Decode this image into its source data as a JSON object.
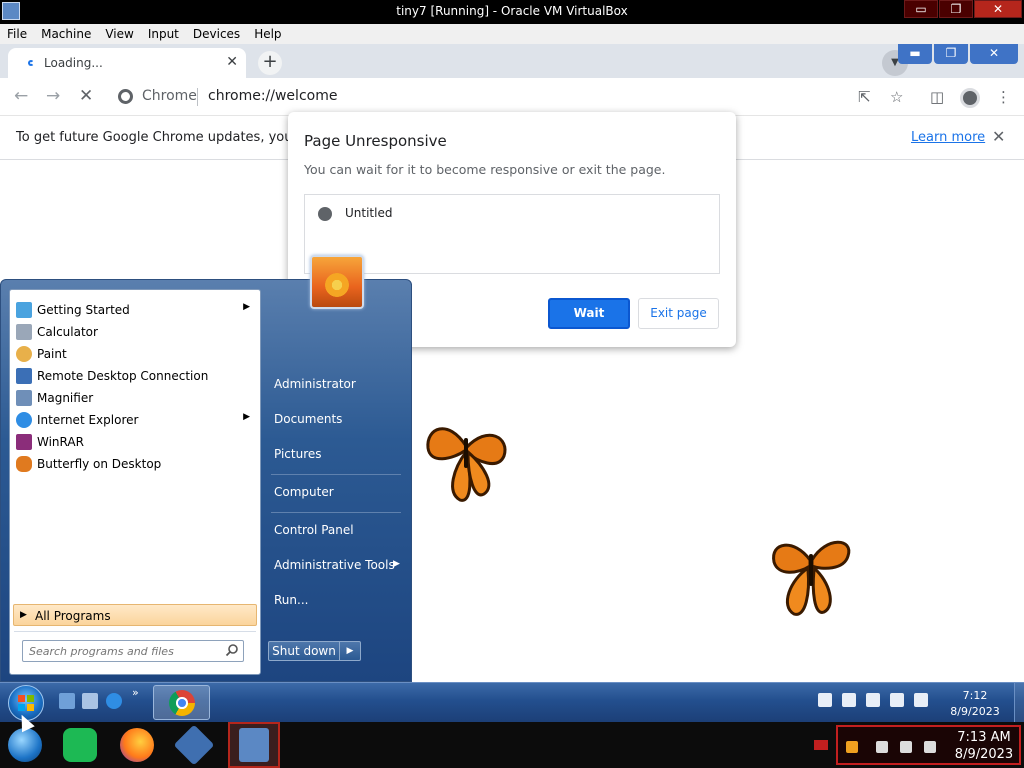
{
  "vbox": {
    "title": "tiny7 [Running] - Oracle VM VirtualBox",
    "menu": [
      "File",
      "Machine",
      "View",
      "Input",
      "Devices",
      "Help"
    ],
    "win_min": "▭",
    "win_restore": "❐",
    "win_close": "✕"
  },
  "chrome": {
    "tab_label": "Loading...",
    "tab_close": "✕",
    "new_tab": "+",
    "tab_search": "▼",
    "win_min": "▬",
    "win_restore": "❐",
    "win_close": "✕",
    "site_chip": "Chrome",
    "url": "chrome://welcome",
    "infobar_text": "To get future Google Chrome updates, you'll ne",
    "infobar_link": "Learn more",
    "infobar_close": "✕"
  },
  "dialog": {
    "title": "Page Unresponsive",
    "message": "You can wait for it to become responsive or exit the page.",
    "page_name": "Untitled",
    "wait_label": "Wait",
    "exit_label": "Exit page"
  },
  "start_menu": {
    "programs": [
      {
        "label": "Getting Started",
        "has_submenu": true,
        "color": "#4aa3df"
      },
      {
        "label": "Calculator",
        "has_submenu": false,
        "color": "#9aa7b8"
      },
      {
        "label": "Paint",
        "has_submenu": false,
        "color": "#e8b04a"
      },
      {
        "label": "Remote Desktop Connection",
        "has_submenu": false,
        "color": "#3b6fb6"
      },
      {
        "label": "Magnifier",
        "has_submenu": false,
        "color": "#6f8fb8"
      },
      {
        "label": "Internet Explorer",
        "has_submenu": true,
        "color": "#2f8de4"
      },
      {
        "label": "WinRAR",
        "has_submenu": false,
        "color": "#8b2d7a"
      },
      {
        "label": "Butterfly on Desktop",
        "has_submenu": false,
        "color": "#e07a1f"
      }
    ],
    "all_programs": "All Programs",
    "search_placeholder": "Search programs and files",
    "right_items": [
      {
        "label": "Administrator"
      },
      {
        "label": "Documents"
      },
      {
        "label": "Pictures"
      },
      {
        "label": "Computer"
      },
      {
        "label": "Control Panel"
      },
      {
        "label": "Administrative Tools"
      },
      {
        "label": "Run..."
      }
    ],
    "shutdown_label": "Shut down"
  },
  "guest_taskbar": {
    "time": "7:12",
    "date": "8/9/2023",
    "more": "»"
  },
  "host_taskbar": {
    "time": "7:13 AM",
    "date": "8/9/2023"
  }
}
